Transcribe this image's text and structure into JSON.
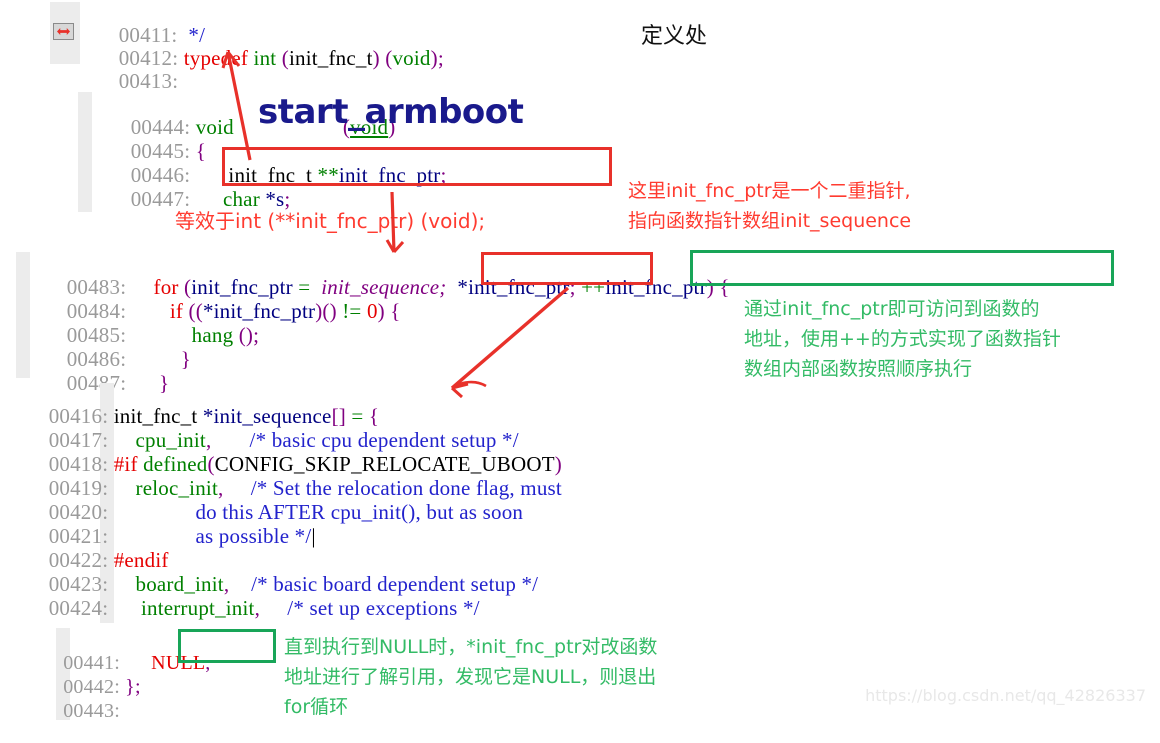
{
  "watermark": "https://blog.csdn.net/qq_42826337",
  "icons": {
    "breakpoint": "breakpoint-icon"
  },
  "snippet1": {
    "lines": [
      {
        "num": "00411:",
        "code": "*/"
      },
      {
        "num": "00412:",
        "code": "typedef int (init_fnc_t) (void);"
      },
      {
        "num": "00413:",
        "code": ""
      }
    ],
    "note": "定义处"
  },
  "snippet2": {
    "lines": [
      {
        "num": "00444:",
        "code": "void start_armboot (void)"
      },
      {
        "num": "00445:",
        "code": "{"
      },
      {
        "num": "00446:",
        "code": "    init_fnc_t **init_fnc_ptr;"
      },
      {
        "num": "00447:",
        "code": "    char *s;"
      }
    ],
    "big_fn": "start_armboot",
    "note_equiv": "等效于int (**init_fnc_ptr) (void);",
    "note_right_line1": "这里init_fnc_ptr是一个二重指针,",
    "note_right_line2": "指向函数指针数组init_sequence"
  },
  "snippet3": {
    "lines": [
      {
        "num": "00483:",
        "code": "    for (init_fnc_ptr = init_sequence; *init_fnc_ptr; ++init_fnc_ptr) {"
      },
      {
        "num": "00484:",
        "code": "        if ((*init_fnc_ptr)() != 0) {"
      },
      {
        "num": "00485:",
        "code": "            hang ();"
      },
      {
        "num": "00486:",
        "code": "        }"
      },
      {
        "num": "00487:",
        "code": "    }"
      }
    ],
    "note_line1": "通过init_fnc_ptr即可访问到函数的",
    "note_line2": "地址，使用++的方式实现了函数指针",
    "note_line3": "数组内部函数按照顺序执行"
  },
  "snippet4": {
    "lines": [
      {
        "num": "00416:",
        "code": "init_fnc_t *init_sequence[] = {"
      },
      {
        "num": "00417:",
        "code": "    cpu_init,        /* basic cpu dependent setup */"
      },
      {
        "num": "00418:",
        "code": "#if defined(CONFIG_SKIP_RELOCATE_UBOOT)"
      },
      {
        "num": "00419:",
        "code": "    reloc_init,      /* Set the relocation done flag, must"
      },
      {
        "num": "00420:",
        "code": "                do this AFTER cpu_init(), but as soon"
      },
      {
        "num": "00421:",
        "code": "                as possible */"
      },
      {
        "num": "00422:",
        "code": "#endif"
      },
      {
        "num": "00423:",
        "code": "    board_init,     /* basic board dependent setup */"
      },
      {
        "num": "00424:",
        "code": "    interrupt_init,    /* set up exceptions */"
      }
    ]
  },
  "snippet5": {
    "lines": [
      {
        "num": "00441:",
        "code": "    NULL,"
      },
      {
        "num": "00442:",
        "code": "};"
      },
      {
        "num": "00443:",
        "code": ""
      }
    ],
    "note_line1": "直到执行到NULL时，*init_fnc_ptr对改函数",
    "note_line2": "地址进行了解引用，发现它是NULL，则退出",
    "note_line3": "for循环"
  },
  "colors": {
    "keyword": "#e50000",
    "type": "#008000",
    "identifier": "#000080",
    "punct": "#800080",
    "comment": "#2222cc",
    "linenum": "#9a9a9a",
    "anno_red": "#ff3b30",
    "anno_green": "#33bb66",
    "box_red": "#e8312a",
    "box_green": "#18a558"
  }
}
